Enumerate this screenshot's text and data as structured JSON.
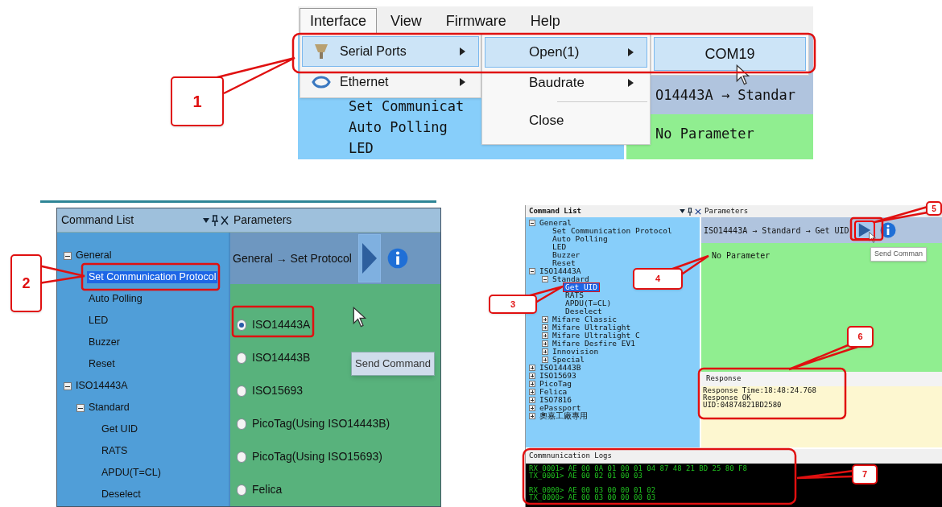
{
  "menu_screenshot": {
    "menubar": [
      {
        "label": "Interface",
        "selected": true
      },
      {
        "label": "View",
        "selected": false
      },
      {
        "label": "Firmware",
        "selected": false
      },
      {
        "label": "Help",
        "selected": false
      }
    ],
    "menu": [
      {
        "label": "Serial Ports",
        "kind": "serial",
        "selected": true
      },
      {
        "label": "Ethernet",
        "kind": "ethernet",
        "selected": false
      }
    ],
    "submenu": [
      {
        "label": "Open(1)",
        "selected": true,
        "has_submenu": true
      },
      {
        "label": "Baudrate",
        "selected": false,
        "has_submenu": true
      },
      {
        "label": "Close",
        "selected": false,
        "has_submenu": false
      }
    ],
    "port_menu": [
      {
        "label": "COM19",
        "selected": true
      }
    ],
    "background_tree": [
      "Set Communicat",
      "Auto Polling",
      "LED"
    ],
    "breadcrumb": "O14443A → Standar",
    "param_text": "No Parameter"
  },
  "protocol_screenshot": {
    "command_list_title": "Command List",
    "parameters_title": "Parameters",
    "breadcrumb": "General → Set Protocol",
    "tooltip": "Send Command",
    "tree": [
      {
        "label": "General",
        "expanded": true,
        "selected": false,
        "children": [
          {
            "label": "Set Communication Protocol",
            "selected": true
          },
          {
            "label": "Auto Polling",
            "selected": false
          },
          {
            "label": "LED",
            "selected": false
          },
          {
            "label": "Buzzer",
            "selected": false
          },
          {
            "label": "Reset",
            "selected": false
          }
        ]
      },
      {
        "label": "ISO14443A",
        "expanded": true,
        "selected": false,
        "children": [
          {
            "label": "Standard",
            "expanded": true,
            "selected": false,
            "children": [
              {
                "label": "Get UID",
                "selected": false
              },
              {
                "label": "RATS",
                "selected": false
              },
              {
                "label": "APDU(T=CL)",
                "selected": false
              },
              {
                "label": "Deselect",
                "selected": false
              }
            ]
          }
        ]
      }
    ],
    "options": [
      {
        "label": "ISO14443A",
        "selected": true
      },
      {
        "label": "ISO14443B",
        "selected": false
      },
      {
        "label": "ISO15693",
        "selected": false
      },
      {
        "label": "PicoTag(Using ISO14443B)",
        "selected": false
      },
      {
        "label": "PicoTag(Using ISO15693)",
        "selected": false
      },
      {
        "label": "Felica",
        "selected": false
      }
    ]
  },
  "getuid_screenshot": {
    "command_list_title": "Command List",
    "parameters_title": "Parameters",
    "breadcrumb": "ISO14443A → Standard → Get UID",
    "param_text": "No Parameter",
    "tooltip": "Send Comman",
    "tree": [
      {
        "label": "General",
        "expanded": true,
        "selected": false,
        "children": [
          {
            "label": "Set Communication Protocol",
            "selected": false
          },
          {
            "label": "Auto Polling",
            "selected": false
          },
          {
            "label": "LED",
            "selected": false
          },
          {
            "label": "Buzzer",
            "selected": false
          },
          {
            "label": "Reset",
            "selected": false
          }
        ]
      },
      {
        "label": "ISO14443A",
        "expanded": true,
        "selected": false,
        "children": [
          {
            "label": "Standard",
            "expanded": true,
            "selected": false,
            "children": [
              {
                "label": "Get UID",
                "selected": true,
                "annotated": true
              },
              {
                "label": "RATS",
                "selected": false
              },
              {
                "label": "APDU(T=CL)",
                "selected": false
              },
              {
                "label": "Deselect",
                "selected": false
              }
            ]
          },
          {
            "label": "Mifare Classic",
            "expanded": false,
            "selected": false
          },
          {
            "label": "Mifare Ultralight",
            "expanded": false,
            "selected": false
          },
          {
            "label": "Mifare Ultralight C",
            "expanded": false,
            "selected": false
          },
          {
            "label": "Mifare Desfire EV1",
            "expanded": false,
            "selected": false
          },
          {
            "label": "Innovision",
            "expanded": false,
            "selected": false
          },
          {
            "label": "Special",
            "expanded": false,
            "selected": false
          }
        ]
      },
      {
        "label": "ISO14443B",
        "expanded": false,
        "selected": false
      },
      {
        "label": "ISO15693",
        "expanded": false,
        "selected": false
      },
      {
        "label": "PicoTag",
        "expanded": false,
        "selected": false
      },
      {
        "label": "Felica",
        "expanded": false,
        "selected": false
      },
      {
        "label": "ISO7816",
        "expanded": false,
        "selected": false
      },
      {
        "label": "ePassport",
        "expanded": false,
        "selected": false
      },
      {
        "label": "奧嘉工廠專用",
        "expanded": false,
        "selected": false
      }
    ],
    "response_title": "Response",
    "response_lines": [
      "Response Time:18:48:24.768",
      "Response OK",
      "UID:04874821BD2580"
    ],
    "logs_title": "Commnunication Logs",
    "log_groups": [
      [
        "RX_0001> AE 00 0A 01 00 01 04 87 48 21 BD 25 80 F8",
        "TX_0001> AE 00 02 01 00 03"
      ],
      [
        "RX_0000> AE 00 03 00 00 01 02",
        "TX_0000> AE 00 03 00 00 00 03"
      ]
    ]
  },
  "callouts": [
    "1",
    "2",
    "3",
    "4",
    "5",
    "6",
    "7"
  ]
}
